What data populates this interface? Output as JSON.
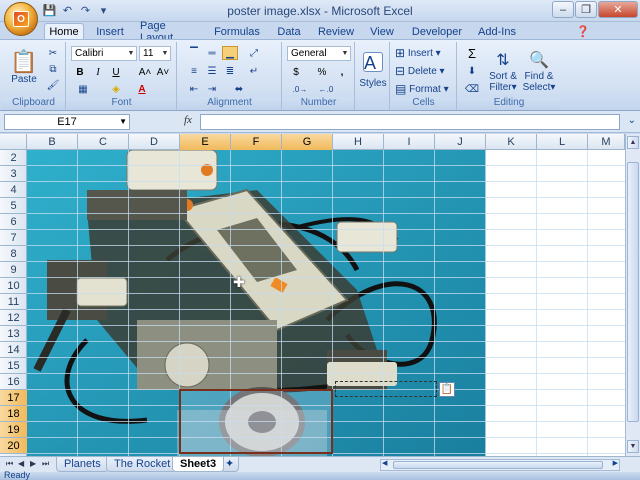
{
  "window": {
    "title": "poster image.xlsx - Microsoft Excel"
  },
  "office_button": {
    "logo": "O"
  },
  "quick_access": [
    {
      "name": "save-icon",
      "glyph": "💾"
    },
    {
      "name": "undo-icon",
      "glyph": "↶"
    },
    {
      "name": "redo-icon",
      "glyph": "↷"
    },
    {
      "name": "customize-icon",
      "glyph": "▾"
    }
  ],
  "window_buttons": {
    "minimize": "–",
    "restore": "❐",
    "close": "✕"
  },
  "ribbon_tabs": [
    "Home",
    "Insert",
    "Page Layout",
    "Formulas",
    "Data",
    "Review",
    "View",
    "Developer",
    "Add-Ins"
  ],
  "active_tab": "Home",
  "ribbon": {
    "clipboard": {
      "label": "Clipboard",
      "paste": "Paste"
    },
    "font": {
      "label": "Font",
      "name": "Calibri",
      "size": "11",
      "bold": "B",
      "italic": "I",
      "underline": "U",
      "grow": "A˄",
      "shrink": "A˅"
    },
    "alignment": {
      "label": "Alignment"
    },
    "number": {
      "label": "Number",
      "format": "General",
      "currency": "$",
      "percent": "%",
      "comma": ","
    },
    "styles": {
      "label": "Styles"
    },
    "cells": {
      "label": "Cells",
      "insert": "Insert",
      "delete": "Delete",
      "format": "Format"
    },
    "editing": {
      "label": "Editing",
      "sum": "Σ",
      "sort": "Sort &",
      "filter": "Filter",
      "find": "Find &",
      "select": "Select"
    }
  },
  "formula_bar": {
    "name_box": "E17",
    "fx": "fx",
    "formula": ""
  },
  "columns": [
    "B",
    "C",
    "D",
    "E",
    "F",
    "G",
    "H",
    "I",
    "J",
    "K",
    "L",
    "M"
  ],
  "selected_columns": [
    "E",
    "F",
    "G"
  ],
  "rows": [
    "2",
    "3",
    "4",
    "5",
    "6",
    "7",
    "8",
    "9",
    "10",
    "11",
    "12",
    "13",
    "14",
    "15",
    "16",
    "17",
    "18",
    "19",
    "20"
  ],
  "selected_rows": [
    "17",
    "18",
    "19",
    "20"
  ],
  "sheets": [
    "Planets",
    "The Rocket",
    "Sheet3"
  ],
  "active_sheet": "Sheet3",
  "status": {
    "text": "Ready"
  },
  "colors": {
    "accent": "#f1b95b",
    "picture_bg": "#1f93b3",
    "selection_border": "#7a2e1c"
  }
}
